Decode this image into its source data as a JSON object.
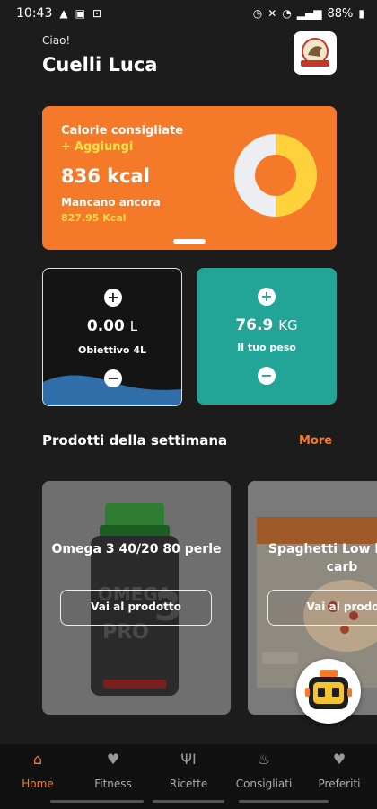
{
  "status_bar": {
    "time": "10:43",
    "battery": "88%"
  },
  "header": {
    "greeting": "Ciao!",
    "user_name": "Cuelli Luca"
  },
  "calories": {
    "title": "Calorie consigliate",
    "add_label": "Aggiungi",
    "value": "836 kcal",
    "remaining_label": "Mancano ancora",
    "remaining_value": "827.95 Kcal",
    "consumed_fraction": 0.5,
    "colors": {
      "card": "#f47a2a",
      "ring_left": "#eceef2",
      "ring_right": "#ffd23c",
      "accent": "#ffe34d"
    }
  },
  "water": {
    "value": "0.00",
    "unit": "L",
    "goal_label": "Obiettivo 4L",
    "plus_symbol": "+",
    "minus_symbol": "−"
  },
  "weight": {
    "value": "76.9",
    "unit": "KG",
    "label": "Il tuo peso",
    "plus_symbol": "+",
    "minus_symbol": "−",
    "color": "#22a596"
  },
  "products_section": {
    "title": "Prodotti della settimana",
    "more_label": "More",
    "items": [
      {
        "title": "Omega 3 40/20 80 perle",
        "button_label": "Vai al prodotto",
        "bottle_lines": [
          "OMEGA",
          "3",
          "PRO"
        ]
      },
      {
        "title": "Spaghetti Low basso carb",
        "button_label": "Vai al prodo"
      }
    ]
  },
  "bottom_nav": {
    "items": [
      {
        "label": "Home",
        "icon": "home-icon",
        "active": true
      },
      {
        "label": "Fitness",
        "icon": "heart-pulse-icon",
        "active": false
      },
      {
        "label": "Ricette",
        "icon": "cutlery-icon",
        "active": false
      },
      {
        "label": "Consigliati",
        "icon": "flame-icon",
        "active": false
      },
      {
        "label": "Preferiti",
        "icon": "heart-icon",
        "active": false
      }
    ]
  }
}
